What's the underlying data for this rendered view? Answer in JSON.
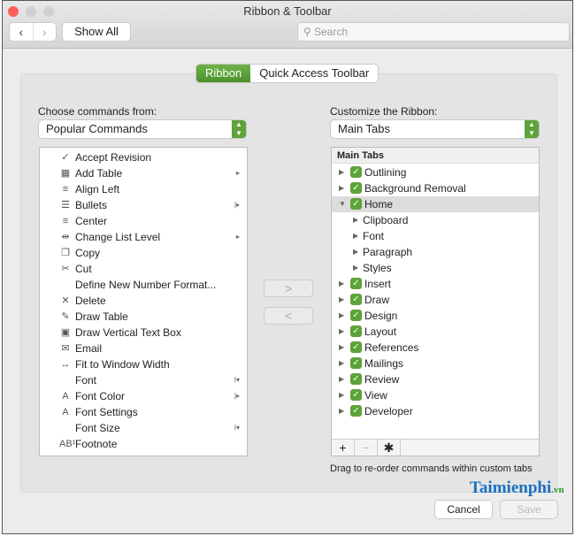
{
  "window": {
    "title": "Ribbon & Toolbar"
  },
  "toolbar": {
    "back": "‹",
    "forward": "›",
    "show_all": "Show All",
    "search_placeholder": "Search"
  },
  "tabs": [
    {
      "label": "Ribbon",
      "active": true
    },
    {
      "label": "Quick Access Toolbar",
      "active": false
    }
  ],
  "left": {
    "label": "Choose commands from:",
    "selected": "Popular Commands",
    "items": [
      {
        "label": "Accept Revision",
        "icon": "accept-revision-icon",
        "glyph": "✓",
        "sub": ""
      },
      {
        "label": "Add Table",
        "icon": "table-icon",
        "glyph": "▦",
        "sub": "▸"
      },
      {
        "label": "Align Left",
        "icon": "align-left-icon",
        "glyph": "≡",
        "sub": ""
      },
      {
        "label": "Bullets",
        "icon": "bullets-icon",
        "glyph": "☰",
        "sub": "|▸"
      },
      {
        "label": "Center",
        "icon": "align-center-icon",
        "glyph": "≡",
        "sub": ""
      },
      {
        "label": "Change List Level",
        "icon": "list-level-icon",
        "glyph": "⇹",
        "sub": "▸"
      },
      {
        "label": "Copy",
        "icon": "copy-icon",
        "glyph": "❐",
        "sub": ""
      },
      {
        "label": "Cut",
        "icon": "scissors-icon",
        "glyph": "✂",
        "sub": ""
      },
      {
        "label": "Define New Number Format...",
        "icon": "",
        "glyph": "",
        "sub": ""
      },
      {
        "label": "Delete",
        "icon": "delete-comment-icon",
        "glyph": "✕",
        "sub": ""
      },
      {
        "label": "Draw Table",
        "icon": "draw-table-icon",
        "glyph": "✎",
        "sub": ""
      },
      {
        "label": "Draw Vertical Text Box",
        "icon": "text-box-icon",
        "glyph": "▣",
        "sub": ""
      },
      {
        "label": "Email",
        "icon": "email-icon",
        "glyph": "✉",
        "sub": ""
      },
      {
        "label": "Fit to Window Width",
        "icon": "fit-width-icon",
        "glyph": "↔",
        "sub": ""
      },
      {
        "label": "Font",
        "icon": "",
        "glyph": "",
        "sub": "I▾"
      },
      {
        "label": "Font Color",
        "icon": "font-color-icon",
        "glyph": "A",
        "sub": "|▸"
      },
      {
        "label": "Font Settings",
        "icon": "font-settings-icon",
        "glyph": "A",
        "sub": ""
      },
      {
        "label": "Font Size",
        "icon": "",
        "glyph": "",
        "sub": "I▾"
      },
      {
        "label": "Footnote",
        "icon": "footnote-icon",
        "glyph": "AB¹",
        "sub": ""
      }
    ]
  },
  "move": {
    "add": ">",
    "remove": "<"
  },
  "right": {
    "label": "Customize the Ribbon:",
    "selected": "Main Tabs",
    "header": "Main Tabs",
    "items": [
      {
        "label": "Outlining",
        "level": 0,
        "expanded": false,
        "checked": true
      },
      {
        "label": "Background Removal",
        "level": 0,
        "expanded": false,
        "checked": true
      },
      {
        "label": "Home",
        "level": 0,
        "expanded": true,
        "checked": true,
        "selected": true
      },
      {
        "label": "Clipboard",
        "level": 1,
        "expanded": false
      },
      {
        "label": "Font",
        "level": 1,
        "expanded": false
      },
      {
        "label": "Paragraph",
        "level": 1,
        "expanded": false
      },
      {
        "label": "Styles",
        "level": 1,
        "expanded": false
      },
      {
        "label": "Insert",
        "level": 0,
        "expanded": false,
        "checked": true
      },
      {
        "label": "Draw",
        "level": 0,
        "expanded": false,
        "checked": true
      },
      {
        "label": "Design",
        "level": 0,
        "expanded": false,
        "checked": true
      },
      {
        "label": "Layout",
        "level": 0,
        "expanded": false,
        "checked": true
      },
      {
        "label": "References",
        "level": 0,
        "expanded": false,
        "checked": true
      },
      {
        "label": "Mailings",
        "level": 0,
        "expanded": false,
        "checked": true
      },
      {
        "label": "Review",
        "level": 0,
        "expanded": false,
        "checked": true
      },
      {
        "label": "View",
        "level": 0,
        "expanded": false,
        "checked": true
      },
      {
        "label": "Developer",
        "level": 0,
        "expanded": false,
        "checked": true
      }
    ],
    "tools": {
      "add": "+",
      "remove": "−",
      "settings": "✱"
    },
    "hint": "Drag to re-order commands within custom tabs"
  },
  "footer": {
    "cancel": "Cancel",
    "save": "Save"
  },
  "watermark": "Taimienphi.vn",
  "colors": {
    "accent": "#5ea23a",
    "close": "#fc5f57"
  }
}
